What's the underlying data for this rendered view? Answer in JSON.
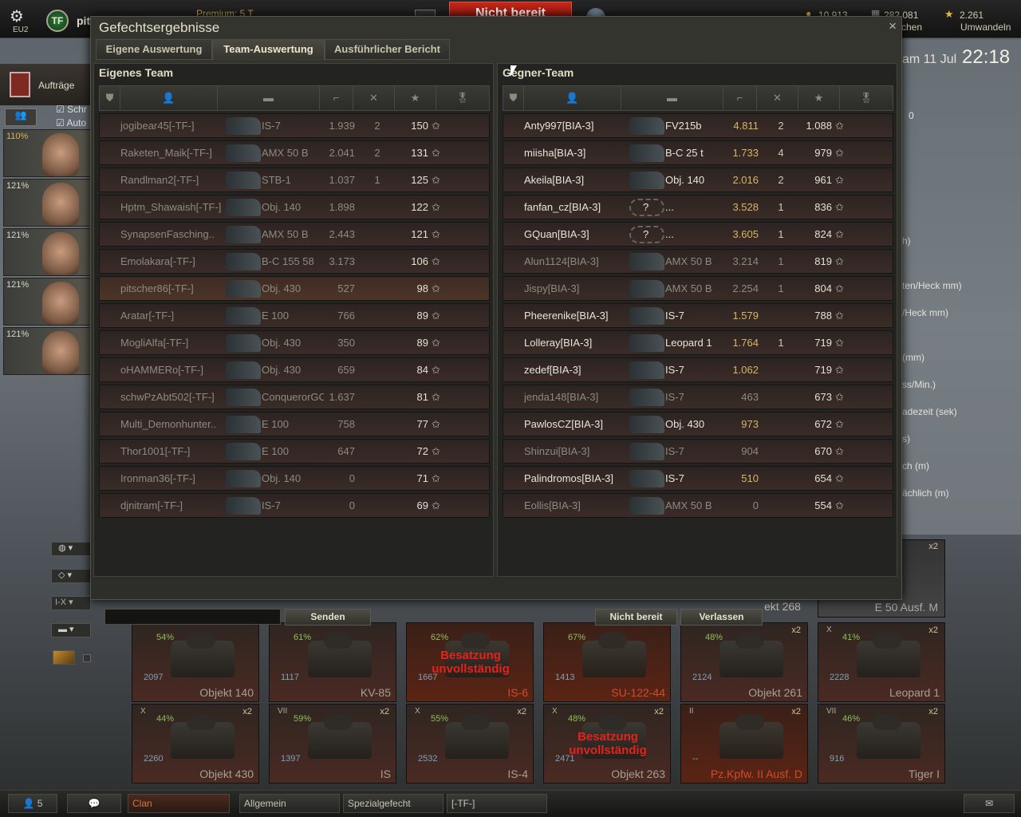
{
  "topbar": {
    "server": "EU2",
    "player_short": "pit",
    "premium": "Premium: 5 T",
    "not_ready": "Nicht bereit",
    "gold": "10.913",
    "credits": "282.081",
    "credits_sub": "chen",
    "free_xp": "2.261",
    "convert": "Umwandeln"
  },
  "garage": {
    "missions": "Aufträge",
    "cb_school": "Schr",
    "cb_auto": "Auto",
    "crew_pct": [
      "110%",
      "121%",
      "121%",
      "121%",
      "121%"
    ],
    "date": "am 11 Jul",
    "time": "22:18",
    "side_zero": "0",
    "side_texts": [
      "h)",
      "ten/Heck mm)",
      "/Heck mm)",
      "(mm)",
      "ss/Min.)",
      "adezeit (sek)",
      "s)",
      "ch (m)",
      "ächlich (m)"
    ],
    "filter_level": "I-X"
  },
  "dialog": {
    "title": "Gefechtsergebnisse",
    "tabs": [
      "Eigene Auswertung",
      "Team-Auswertung",
      "Ausführlicher Bericht"
    ],
    "own_team": "Eigenes Team",
    "enemy_team": "Gegner-Team",
    "send": "Senden",
    "not_ready": "Nicht bereit",
    "leave": "Verlassen",
    "close": "×"
  },
  "own_rows": [
    {
      "name": "jogibear45[-TF-]",
      "tank": "IS-7",
      "dmg": "1.939",
      "kills": "2",
      "xp": "150",
      "alive": false
    },
    {
      "name": "Raketen_Maik[-TF-]",
      "tank": "AMX 50 B",
      "dmg": "2.041",
      "kills": "2",
      "xp": "131",
      "alive": false
    },
    {
      "name": "Randlman2[-TF-]",
      "tank": "STB-1",
      "dmg": "1.037",
      "kills": "1",
      "xp": "125",
      "alive": false
    },
    {
      "name": "Hptm_Shawaish[-TF-]",
      "tank": "Obj. 140",
      "dmg": "1.898",
      "kills": "",
      "xp": "122",
      "alive": false
    },
    {
      "name": "SynapsenFasching..",
      "tank": "AMX 50 B",
      "dmg": "2.443",
      "kills": "",
      "xp": "121",
      "alive": false
    },
    {
      "name": "Emolakara[-TF-]",
      "tank": "B-C 155 58",
      "dmg": "3.173",
      "kills": "",
      "xp": "106",
      "alive": false
    },
    {
      "name": "pitscher86[-TF-]",
      "tank": "Obj. 430",
      "dmg": "527",
      "kills": "",
      "xp": "98",
      "alive": false,
      "me": true
    },
    {
      "name": "Aratar[-TF-]",
      "tank": "E 100",
      "dmg": "766",
      "kills": "",
      "xp": "89",
      "alive": false
    },
    {
      "name": "MogliAlfa[-TF-]",
      "tank": "Obj. 430",
      "dmg": "350",
      "kills": "",
      "xp": "89",
      "alive": false
    },
    {
      "name": "oHAMMERo[-TF-]",
      "tank": "Obj. 430",
      "dmg": "659",
      "kills": "",
      "xp": "84",
      "alive": false
    },
    {
      "name": "schwPzAbt502[-TF-]",
      "tank": "ConquerorGC",
      "dmg": "1.637",
      "kills": "",
      "xp": "81",
      "alive": false
    },
    {
      "name": "Multi_Demonhunter..",
      "tank": "E 100",
      "dmg": "758",
      "kills": "",
      "xp": "77",
      "alive": false
    },
    {
      "name": "Thor1001[-TF-]",
      "tank": "E 100",
      "dmg": "647",
      "kills": "",
      "xp": "72",
      "alive": false
    },
    {
      "name": "Ironman36[-TF-]",
      "tank": "Obj. 140",
      "dmg": "0",
      "kills": "",
      "xp": "71",
      "alive": false
    },
    {
      "name": "djnitram[-TF-]",
      "tank": "IS-7",
      "dmg": "0",
      "kills": "",
      "xp": "69",
      "alive": false
    }
  ],
  "enemy_rows": [
    {
      "name": "Anty997[BIA-3]",
      "tank": "FV215b",
      "dmg": "4.811",
      "kills": "2",
      "xp": "1.088",
      "alive": true
    },
    {
      "name": "miisha[BIA-3]",
      "tank": "B-C 25 t",
      "dmg": "1.733",
      "kills": "4",
      "xp": "979",
      "alive": true
    },
    {
      "name": "Akeila[BIA-3]",
      "tank": "Obj. 140",
      "dmg": "2.016",
      "kills": "2",
      "xp": "961",
      "alive": true
    },
    {
      "name": "fanfan_cz[BIA-3]",
      "tank": "...",
      "dmg": "3.528",
      "kills": "1",
      "xp": "836",
      "alive": true,
      "unknown": true
    },
    {
      "name": "GQuan[BIA-3]",
      "tank": "...",
      "dmg": "3.605",
      "kills": "1",
      "xp": "824",
      "alive": true,
      "unknown": true
    },
    {
      "name": "Alun1124[BIA-3]",
      "tank": "AMX 50 B",
      "dmg": "3.214",
      "kills": "1",
      "xp": "819",
      "alive": false
    },
    {
      "name": "Jispy[BIA-3]",
      "tank": "AMX 50 B",
      "dmg": "2.254",
      "kills": "1",
      "xp": "804",
      "alive": false
    },
    {
      "name": "Pheerenike[BIA-3]",
      "tank": "IS-7",
      "dmg": "1.579",
      "kills": "",
      "xp": "788",
      "alive": true
    },
    {
      "name": "Lolleray[BIA-3]",
      "tank": "Leopard 1",
      "dmg": "1.764",
      "kills": "1",
      "xp": "719",
      "alive": true
    },
    {
      "name": "zedef[BIA-3]",
      "tank": "IS-7",
      "dmg": "1.062",
      "kills": "",
      "xp": "719",
      "alive": true
    },
    {
      "name": "jenda148[BIA-3]",
      "tank": "IS-7",
      "dmg": "463",
      "kills": "",
      "xp": "673",
      "alive": false
    },
    {
      "name": "PawlosCZ[BIA-3]",
      "tank": "Obj. 430",
      "dmg": "973",
      "kills": "",
      "xp": "672",
      "alive": true
    },
    {
      "name": "Shinzui[BIA-3]",
      "tank": "IS-7",
      "dmg": "904",
      "kills": "",
      "xp": "670",
      "alive": false
    },
    {
      "name": "Palindromos[BIA-3]",
      "tank": "IS-7",
      "dmg": "510",
      "kills": "",
      "xp": "654",
      "alive": true
    },
    {
      "name": "Eollis[BIA-3]",
      "tank": "AMX 50 B",
      "dmg": "0",
      "kills": "",
      "xp": "554",
      "alive": false
    }
  ],
  "carousel": [
    {
      "name": "Objekt 140",
      "battles": "2097",
      "pct": "54%",
      "tier": "",
      "x2": "",
      "warn": ""
    },
    {
      "name": "KV-85",
      "battles": "1117",
      "pct": "61%",
      "tier": "",
      "x2": "",
      "warn": ""
    },
    {
      "name": "IS-6",
      "battles": "1667",
      "pct": "62%",
      "tier": "",
      "x2": "",
      "warn": "Besatzung unvollständig",
      "red": true
    },
    {
      "name": "SU-122-44",
      "battles": "1413",
      "pct": "67%",
      "tier": "",
      "x2": "",
      "warn": "",
      "red": true
    },
    {
      "name": "Objekt 261",
      "battles": "2124",
      "pct": "48%",
      "tier": "",
      "x2": "x2",
      "warn": ""
    },
    {
      "name": "Leopard 1",
      "battles": "2228",
      "pct": "41%",
      "tier": "X",
      "x2": "x2",
      "warn": ""
    },
    {
      "name": "Objekt 430",
      "battles": "2260",
      "pct": "44%",
      "tier": "X",
      "x2": "x2",
      "warn": ""
    },
    {
      "name": "IS",
      "battles": "1397",
      "pct": "59%",
      "tier": "VII",
      "x2": "x2",
      "warn": ""
    },
    {
      "name": "IS-4",
      "battles": "2532",
      "pct": "55%",
      "tier": "X",
      "x2": "x2",
      "warn": ""
    },
    {
      "name": "Objekt 263",
      "battles": "2471",
      "pct": "48%",
      "tier": "X",
      "x2": "x2",
      "warn": "Besatzung unvollständig"
    },
    {
      "name": "Pz.Kpfw. II Ausf. D",
      "battles": "--",
      "pct": "",
      "tier": "II",
      "x2": "x2",
      "warn": "",
      "red": true
    },
    {
      "name": "Tiger I",
      "battles": "916",
      "pct": "46%",
      "tier": "VII",
      "x2": "x2",
      "warn": ""
    }
  ],
  "carousel_top": [
    "ekt 268",
    "E 50 Ausf. M"
  ],
  "bottombar": {
    "players": "5",
    "clan": "Clan",
    "general": "Allgemein",
    "special": "Spezialgefecht",
    "tf": "[-TF-]"
  }
}
